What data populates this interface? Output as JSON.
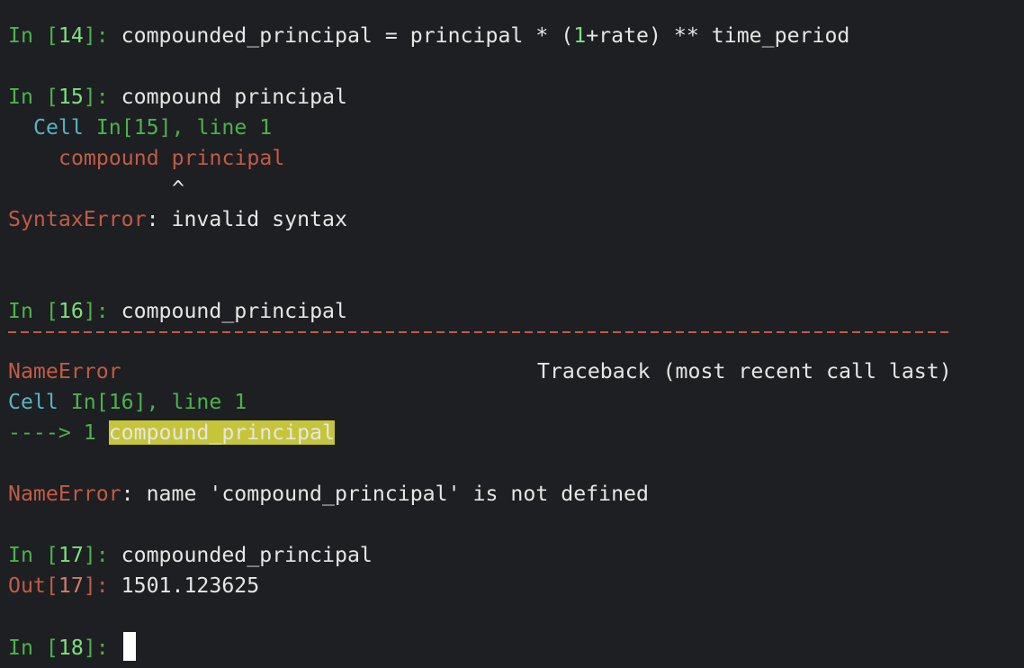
{
  "cells": {
    "c14": {
      "in_word": "In ",
      "num": "14",
      "code": "compounded_principal = principal * (",
      "code_num": "1",
      "code_rest": "+rate) ** time_period"
    },
    "c15": {
      "in_word": "In ",
      "num": "15",
      "code": "compound principal",
      "trace_cell": "Cell ",
      "trace_in": "In[15], line 1",
      "err_code_a": "compound ",
      "err_code_b": "principal",
      "caret": "^",
      "err_type": "SyntaxError",
      "err_msg": "invalid syntax"
    },
    "c16": {
      "in_word": "In ",
      "num": "16",
      "code": "compound_principal",
      "err_type": "NameError",
      "traceback": "Traceback (most recent call last)",
      "trace_cell": "Cell ",
      "trace_in": "In[16], line 1",
      "arrow": "----> 1 ",
      "highlight": "compound_principal",
      "err_msg": "name 'compound_principal' is not defined"
    },
    "c17": {
      "in_word": "In ",
      "num": "17",
      "code": "compounded_principal",
      "out_word": "Out",
      "out_num": "17",
      "result": "1501.123625"
    },
    "c18": {
      "in_word": "In ",
      "num": "18"
    }
  },
  "colors": {
    "background": "#1e1f22",
    "prompt_green": "#4bb34b",
    "error_red": "#c25b44",
    "cyan": "#58b3c4",
    "highlight": "#c6c53a"
  }
}
